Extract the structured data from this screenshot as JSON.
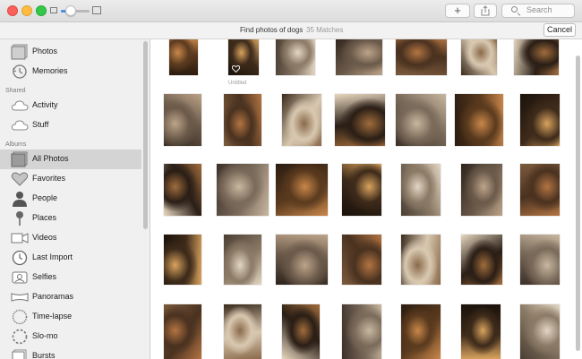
{
  "toolbar": {
    "add_label": "+",
    "search_placeholder": "Search",
    "zoom_level": 0.35
  },
  "find": {
    "query": "Find photos of dogs",
    "matches": "35 Matches",
    "cancel_label": "Cancel"
  },
  "sidebar": {
    "top_items": [
      {
        "label": "Photos",
        "icon": "photos-icon"
      },
      {
        "label": "Memories",
        "icon": "memories-icon"
      }
    ],
    "shared_header": "Shared",
    "shared_items": [
      {
        "label": "Activity",
        "icon": "cloud-icon"
      },
      {
        "label": "Stuff",
        "icon": "cloud-icon"
      }
    ],
    "albums_header": "Albums",
    "album_items": [
      {
        "label": "All Photos",
        "icon": "all-photos-icon",
        "selected": true
      },
      {
        "label": "Favorites",
        "icon": "heart-icon"
      },
      {
        "label": "People",
        "icon": "person-icon"
      },
      {
        "label": "Places",
        "icon": "pin-icon"
      },
      {
        "label": "Videos",
        "icon": "video-icon"
      },
      {
        "label": "Last Import",
        "icon": "clock-icon"
      },
      {
        "label": "Selfies",
        "icon": "selfie-icon"
      },
      {
        "label": "Panoramas",
        "icon": "panorama-icon"
      },
      {
        "label": "Time-lapse",
        "icon": "timelapse-icon"
      },
      {
        "label": "Slo-mo",
        "icon": "slomo-icon"
      },
      {
        "label": "Bursts",
        "icon": "bursts-icon"
      }
    ]
  },
  "photos": {
    "untitled_label": "Untitled"
  },
  "colors": {
    "selected_row": "#d4d4d4",
    "sidebar_bg": "#f0f0f0",
    "accent": "#4a90e2"
  }
}
